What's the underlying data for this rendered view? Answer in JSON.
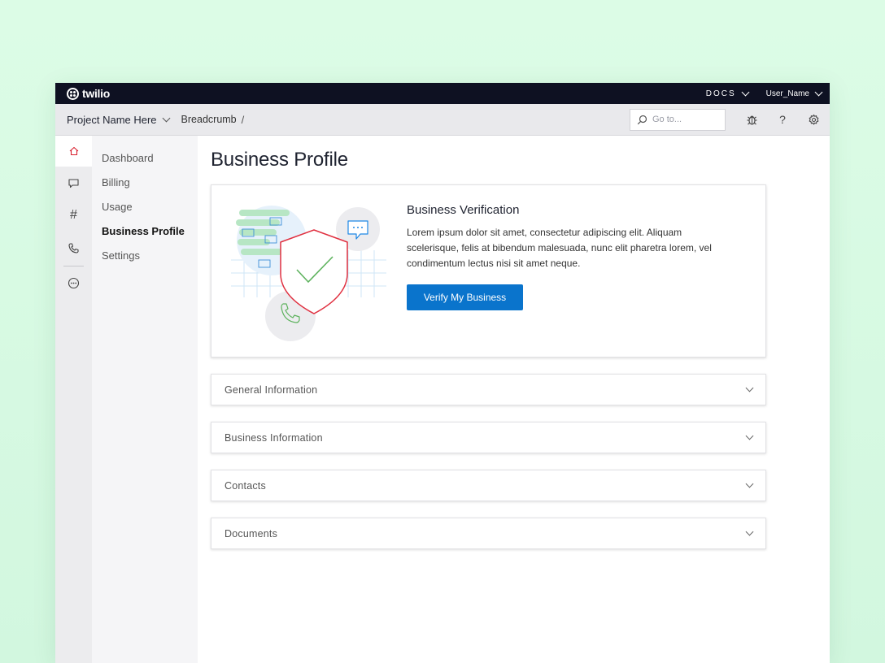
{
  "brand": {
    "name": "twilio"
  },
  "topbar": {
    "docs_label": "DOCS",
    "user_label": "User_Name"
  },
  "crumbbar": {
    "project": "Project Name Here",
    "breadcrumb": "Breadcrumb",
    "separator": "/",
    "goto_placeholder": "Go to...",
    "icons": [
      "debugger-bug-icon",
      "help-icon",
      "settings-gear-icon"
    ]
  },
  "rail": {
    "items": [
      {
        "icon": "home-icon",
        "active": true
      },
      {
        "icon": "chat-icon",
        "active": false
      },
      {
        "icon": "hash-icon",
        "active": false
      },
      {
        "icon": "phone-icon",
        "active": false
      },
      {
        "icon": "more-icon",
        "active": false
      }
    ],
    "active_color": "#d8202e"
  },
  "subnav": {
    "items": [
      {
        "label": "Dashboard"
      },
      {
        "label": "Billing"
      },
      {
        "label": "Usage"
      },
      {
        "label": "Business Profile",
        "active": true
      },
      {
        "label": "Settings"
      }
    ]
  },
  "main": {
    "title": "Business Profile",
    "verification": {
      "title": "Business Verification",
      "description": "Lorem ipsum dolor sit amet, consectetur adipiscing elit. Aliquam scelerisque, felis at bibendum malesuada, nunc elit pharetra lorem, vel condimentum lectus nisi sit amet neque.",
      "button_label": "Verify My Business",
      "button_color": "#0a74cc"
    },
    "sections": [
      {
        "label": "General Information"
      },
      {
        "label": "Business Information"
      },
      {
        "label": "Contacts"
      },
      {
        "label": "Documents"
      }
    ]
  }
}
